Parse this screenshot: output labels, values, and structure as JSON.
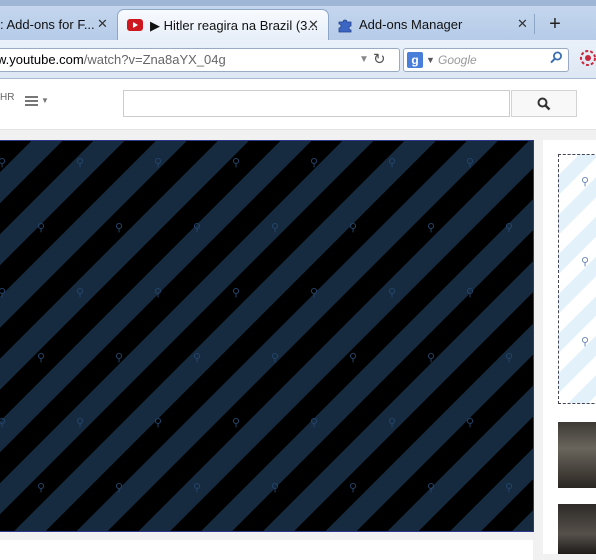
{
  "browser": {
    "tabs": [
      {
        "label": ": Add-ons for F...",
        "close": "✕",
        "active": false
      },
      {
        "label": "▶ Hitler reagira na Brazil (3...",
        "close": "✕",
        "active": true
      },
      {
        "label": "Add-ons Manager",
        "close": "✕",
        "active": false
      }
    ],
    "new_tab": "+",
    "url": {
      "host": "w.youtube.com",
      "rest": "/watch?v=Zna8aYX_04g"
    },
    "search_placeholder": "Google"
  },
  "youtube": {
    "region": "HR",
    "search_value": ""
  },
  "colors": {
    "youtube_red": "#cc181e",
    "player_stripe_dark": "#000000",
    "player_stripe_light": "#172b40",
    "ad_stripe": "#e3f1fb",
    "tab_bg": "#c7d8ef"
  },
  "icons": {
    "youtube_tab": "youtube-icon",
    "addons_tab": "puzzle-icon",
    "reload": "reload-icon",
    "search_engine": "google-icon",
    "search_go": "magnifier-icon",
    "addon_toolbar": "adblock-icon",
    "guide": "hamburger-icon",
    "yt_search": "search-icon",
    "blocked_plugin": "plugin-icon"
  }
}
